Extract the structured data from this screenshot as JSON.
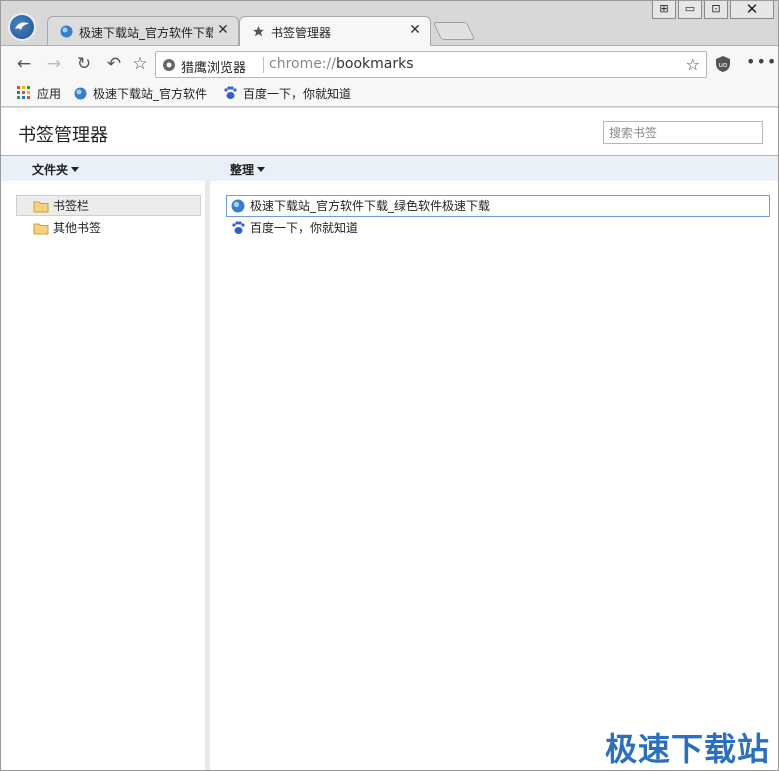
{
  "window": {
    "controls": [
      "⊞",
      "▭",
      "⊡",
      "✕"
    ]
  },
  "tabs": [
    {
      "title": "极速下载站_官方软件下载",
      "icon": "site-globe-icon",
      "close": "✕",
      "active": false
    },
    {
      "title": "书签管理器",
      "icon": "star-icon",
      "close": "✕",
      "active": true
    }
  ],
  "toolbar": {
    "back": "←",
    "forward": "→",
    "reload": "↻",
    "undo": "↶",
    "favorite": "☆",
    "omnibox": {
      "site_name": "猎鹰浏览器",
      "url_scheme": "chrome://",
      "url_path": "bookmarks",
      "star": "☆"
    },
    "menu": "•••"
  },
  "bookmarks_bar": [
    {
      "label": "应用",
      "icon": "apps-grid-icon"
    },
    {
      "label": "极速下载站_官方软件",
      "icon": "site-globe-icon"
    },
    {
      "label": "百度一下，你就知道",
      "icon": "baidu-paw-icon"
    }
  ],
  "manager": {
    "title": "书签管理器",
    "search_placeholder": "搜索书签",
    "folders_menu": "文件夹",
    "organize_menu": "整理",
    "folders": [
      {
        "label": "书签栏",
        "selected": true
      },
      {
        "label": "其他书签",
        "selected": false
      }
    ],
    "bookmarks": [
      {
        "label": "极速下载站_官方软件下载_绿色软件极速下载",
        "icon": "site-globe-icon",
        "focused": true
      },
      {
        "label": "百度一下，你就知道",
        "icon": "baidu-paw-icon",
        "focused": false
      }
    ]
  },
  "watermark": "极速下载站",
  "colors": {
    "accent": "#2b6fbf",
    "header_border": "#9fb4d4",
    "column_header_bg": "#eaf0f8"
  }
}
